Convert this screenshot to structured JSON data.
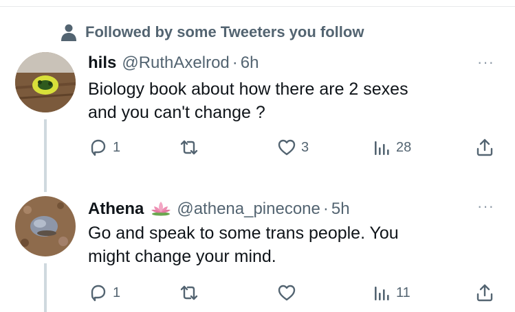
{
  "social_context": {
    "text": "Followed by some Tweeters you follow",
    "icon": "person-icon"
  },
  "tweets": [
    {
      "name": "hils",
      "handle": "@RuthAxelrod",
      "separator": "·",
      "time": "6h",
      "more": "···",
      "text_lines": [
        "Biology book about how there are 2 sexes",
        "and you can't change ?"
      ],
      "replies": "1",
      "retweets": "",
      "likes": "3",
      "views": "28"
    },
    {
      "name": "Athena",
      "emoji": "lotus-emoji",
      "handle": "@athena_pinecone",
      "separator": "·",
      "time": "5h",
      "more": "···",
      "text_lines": [
        "Go and speak to some trans people. You",
        "might change your mind."
      ],
      "replies": "1",
      "retweets": "",
      "likes": "",
      "views": "11"
    }
  ],
  "colors": {
    "text": "#0f1419",
    "secondary": "#536471",
    "divider": "#e7e9ea",
    "thread": "#cfd9de"
  }
}
